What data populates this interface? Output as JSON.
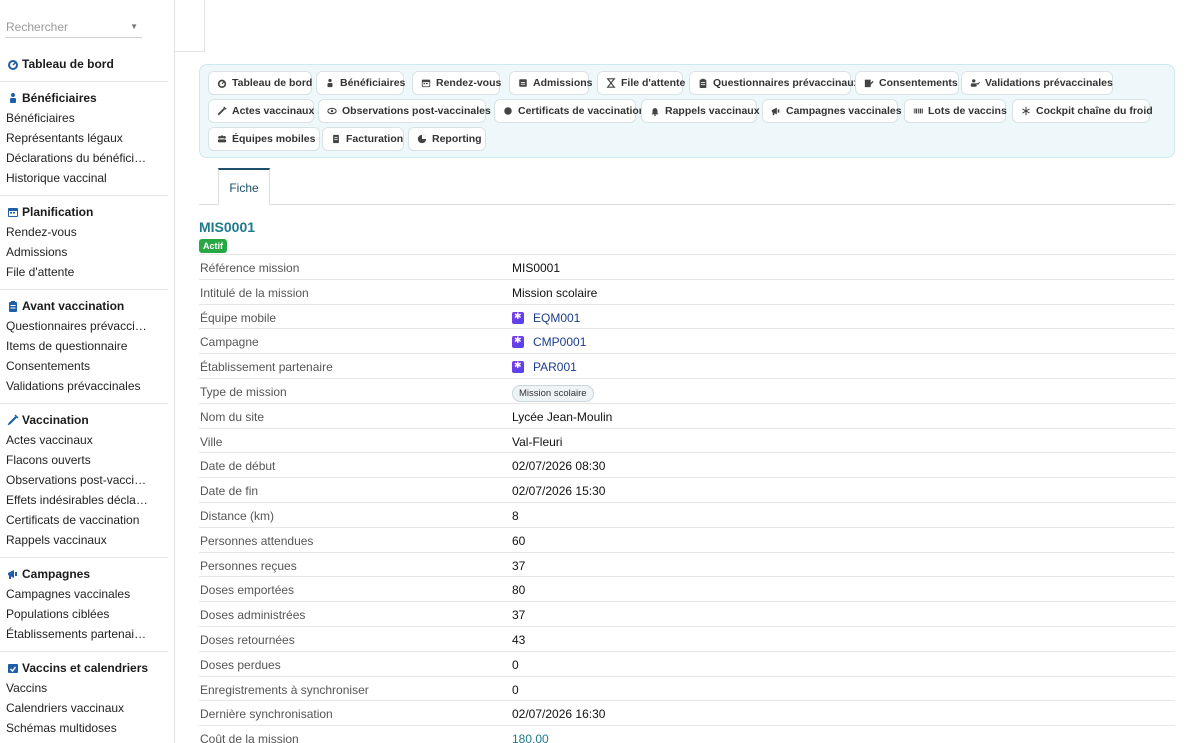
{
  "search": {
    "placeholder": "Rechercher"
  },
  "sidebar": {
    "dashboard": "Tableau de bord",
    "sections": [
      {
        "title": "Bénéficiaires",
        "icon": "people-icon",
        "items": [
          "Bénéficiaires",
          "Représentants légaux",
          "Déclarations du bénéficia…",
          "Historique vaccinal"
        ]
      },
      {
        "title": "Planification",
        "icon": "calendar-icon",
        "items": [
          "Rendez-vous",
          "Admissions",
          "File d'attente"
        ]
      },
      {
        "title": "Avant vaccination",
        "icon": "clipboard-icon",
        "items": [
          "Questionnaires prévaccin…",
          "Items de questionnaire",
          "Consentements",
          "Validations prévaccinales"
        ]
      },
      {
        "title": "Vaccination",
        "icon": "syringe-icon",
        "items": [
          "Actes vaccinaux",
          "Flacons ouverts",
          "Observations post-vaccin…",
          "Effets indésirables déclarés",
          "Certificats de vaccination",
          "Rappels vaccinaux"
        ]
      },
      {
        "title": "Campagnes",
        "icon": "megaphone-icon",
        "items": [
          "Campagnes vaccinales",
          "Populations ciblées",
          "Établissements partenaires"
        ]
      },
      {
        "title": "Vaccins et calendriers",
        "icon": "calendar-check-icon",
        "items": [
          "Vaccins",
          "Calendriers vaccinaux",
          "Schémas multidoses"
        ]
      }
    ]
  },
  "quicknav": [
    {
      "label": "Tableau de bord",
      "icon": "dashboard-icon"
    },
    {
      "label": "Bénéficiaires",
      "icon": "people-icon"
    },
    {
      "label": "Rendez-vous",
      "icon": "calendar-icon"
    },
    {
      "label": "Admissions",
      "icon": "id-card-icon"
    },
    {
      "label": "File d'attente",
      "icon": "hourglass-icon"
    },
    {
      "label": "Questionnaires prévaccinaux",
      "icon": "clipboard-icon"
    },
    {
      "label": "Consentements",
      "icon": "signature-icon"
    },
    {
      "label": "Validations prévaccinales",
      "icon": "user-check-icon"
    },
    {
      "label": "Actes vaccinaux",
      "icon": "syringe-icon"
    },
    {
      "label": "Observations post-vaccinales",
      "icon": "eye-icon"
    },
    {
      "label": "Certificats de vaccination",
      "icon": "certificate-icon"
    },
    {
      "label": "Rappels vaccinaux",
      "icon": "bell-icon"
    },
    {
      "label": "Campagnes vaccinales",
      "icon": "megaphone-icon"
    },
    {
      "label": "Lots de vaccins",
      "icon": "barcode-icon"
    },
    {
      "label": "Cockpit chaîne du froid",
      "icon": "snowflake-icon"
    },
    {
      "label": "Équipes mobiles",
      "icon": "team-icon"
    },
    {
      "label": "Facturation",
      "icon": "invoice-icon"
    },
    {
      "label": "Reporting",
      "icon": "pie-chart-icon"
    }
  ],
  "tab": {
    "label": "Fiche"
  },
  "record": {
    "title": "MIS0001",
    "status": "Actif",
    "fields": [
      {
        "label": "Référence mission",
        "value": "MIS0001",
        "kind": "text"
      },
      {
        "label": "Intitulé de la mission",
        "value": "Mission scolaire",
        "kind": "text"
      },
      {
        "label": "Équipe mobile",
        "value": "EQM001",
        "kind": "link"
      },
      {
        "label": "Campagne",
        "value": "CMP0001",
        "kind": "link"
      },
      {
        "label": "Établissement partenaire",
        "value": "PAR001",
        "kind": "link"
      },
      {
        "label": "Type de mission",
        "value": "Mission scolaire",
        "kind": "pill"
      },
      {
        "label": "Nom du site",
        "value": "Lycée Jean-Moulin",
        "kind": "text"
      },
      {
        "label": "Ville",
        "value": "Val-Fleuri",
        "kind": "text"
      },
      {
        "label": "Date de début",
        "value": "02/07/2026 08:30",
        "kind": "text"
      },
      {
        "label": "Date de fin",
        "value": "02/07/2026 15:30",
        "kind": "text"
      },
      {
        "label": "Distance (km)",
        "value": "8",
        "kind": "text"
      },
      {
        "label": "Personnes attendues",
        "value": "60",
        "kind": "text"
      },
      {
        "label": "Personnes reçues",
        "value": "37",
        "kind": "text"
      },
      {
        "label": "Doses emportées",
        "value": "80",
        "kind": "text"
      },
      {
        "label": "Doses administrées",
        "value": "37",
        "kind": "text"
      },
      {
        "label": "Doses retournées",
        "value": "43",
        "kind": "text"
      },
      {
        "label": "Doses perdues",
        "value": "0",
        "kind": "text"
      },
      {
        "label": "Enregistrements à synchroniser",
        "value": "0",
        "kind": "text"
      },
      {
        "label": "Dernière synchronisation",
        "value": "02/07/2026 16:30",
        "kind": "text"
      },
      {
        "label": "Coût de la mission",
        "value": "180,00",
        "kind": "money"
      }
    ]
  },
  "colors": {
    "accent": "#1f7a8c",
    "badge": "#28a745",
    "link": "#1a3d8f",
    "icon": "#1e5fa8"
  }
}
